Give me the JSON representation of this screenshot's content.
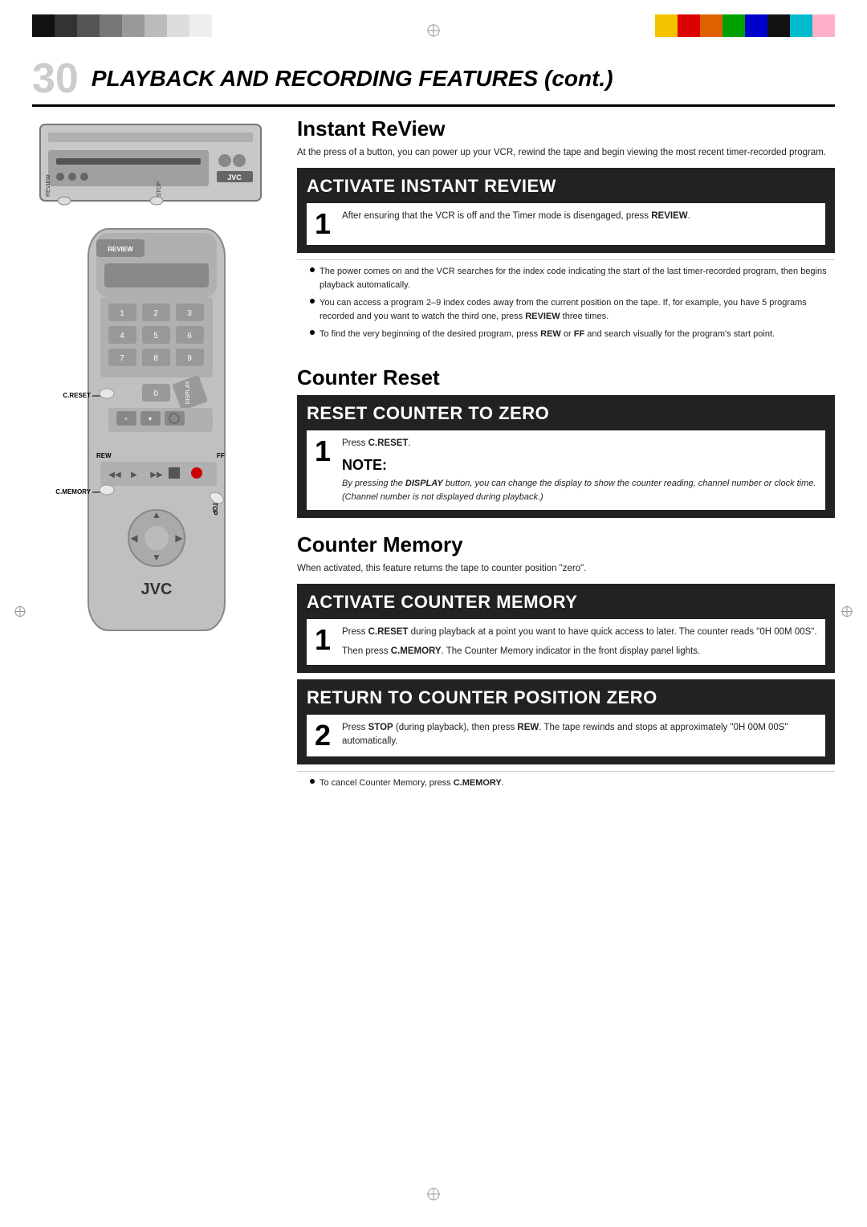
{
  "colorBarsLeft": [
    "#000",
    "#888",
    "#666",
    "#444",
    "#333",
    "#222",
    "#111",
    "#555",
    "#777",
    "#999"
  ],
  "colorBarsRight": [
    "#f5c200",
    "#e00",
    "#e06000",
    "#00a000",
    "#0000cc",
    "#000",
    "#00bbcc",
    "#ffb6c1"
  ],
  "pageNumber": "30",
  "pageTitle": "PLAYBACK AND RECORDING FEATURES (cont.)",
  "sections": {
    "instantReview": {
      "title": "Instant ReView",
      "intro": "At the press of a button, you can power up your VCR, rewind the tape and begin viewing the most recent timer-recorded program.",
      "stepBlockTitle": "ACTIVATE INSTANT REVIEW",
      "step1": {
        "number": "1",
        "text": "After ensuring that the VCR is off and the Timer mode is disengaged, press ",
        "boldText": "REVIEW",
        "textAfter": "."
      },
      "bullets": [
        "The power comes on and the VCR searches for the index code indicating the start of the last timer-recorded program, then begins playback automatically.",
        "You can access a program 2–9 index codes away from the current position on the tape. If, for example, you have 5 programs recorded and you want to watch the third one, press REVIEW three times.",
        "To find the very beginning of the desired program, press REW or FF and search visually for the program's start point."
      ]
    },
    "counterReset": {
      "title": "Counter Reset",
      "stepBlockTitle": "RESET COUNTER TO ZERO",
      "step1": {
        "number": "1",
        "pressText": "Press ",
        "boldText": "C.RESET",
        "textAfter": "."
      },
      "noteTitle": "NOTE:",
      "noteText": "By pressing the DISPLAY button, you can change the display to show the counter reading, channel number or clock time. (Channel number is not displayed during playback.)"
    },
    "counterMemory": {
      "title": "Counter Memory",
      "intro": "When activated, this feature returns the tape to counter position \"zero\".",
      "activateTitle": "ACTIVATE COUNTER MEMORY",
      "activateStep": {
        "number": "1",
        "text": "Press ",
        "boldText": "C.RESET",
        "textAfter": " during playback at a point you want to have quick access to later. The counter reads \"0H 00M 00S\"."
      },
      "activateStep2Text": "Then press ",
      "activateStep2Bold": "C.MEMORY",
      "activateStep2After": ". The Counter Memory indicator in the front display panel lights.",
      "returnTitle": "RETURN TO COUNTER POSITION ZERO",
      "returnStep": {
        "number": "2",
        "text": "Press ",
        "boldText1": "STOP",
        "text2": " (during playback), then press ",
        "boldText2": "REW",
        "text3": ". The tape rewinds and stops at approximately \"0H 00M 00S\" automatically."
      },
      "returnBullet": "To cancel Counter Memory, press ",
      "returnBulletBold": "C.MEMORY",
      "returnBulletAfter": "."
    }
  }
}
